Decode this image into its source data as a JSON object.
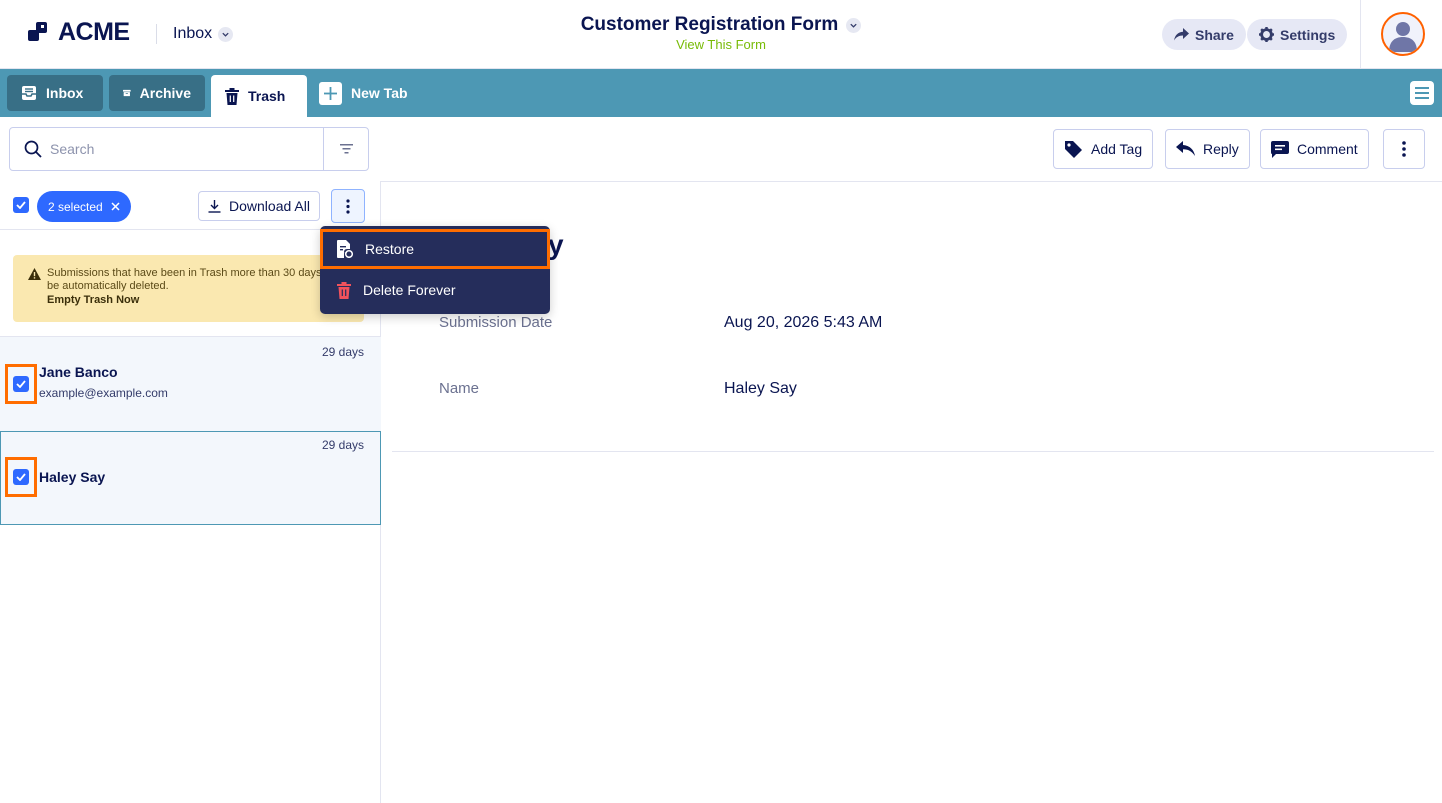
{
  "header": {
    "brand": "ACME",
    "inbox_label": "Inbox",
    "form_title": "Customer Registration Form",
    "form_subtitle": "View This Form",
    "share_label": "Share",
    "settings_label": "Settings"
  },
  "tabs": [
    {
      "label": "Inbox",
      "icon": "inbox-icon"
    },
    {
      "label": "Archive",
      "icon": "archive-icon"
    },
    {
      "label": "Trash",
      "icon": "trash-icon",
      "active": true
    },
    {
      "label": "New Tab",
      "icon": "plus-icon"
    }
  ],
  "search": {
    "placeholder": "Search",
    "value": ""
  },
  "actions": {
    "add_tag": "Add Tag",
    "reply": "Reply",
    "comment": "Comment"
  },
  "selection": {
    "badge": "2 selected",
    "download_all": "Download All"
  },
  "warning": {
    "text": "Submissions that have been in Trash more than 30 days will be automatically deleted.",
    "link": "Empty Trash Now"
  },
  "submissions": [
    {
      "name": "Jane Banco",
      "email": "example@example.com",
      "age": "29 days",
      "checked": true
    },
    {
      "name": "Haley Say",
      "email": "",
      "age": "29 days",
      "checked": true
    }
  ],
  "detail": {
    "title_fragment": "y",
    "fields": [
      {
        "label": "Submission Date",
        "value": "Aug 20, 2026 5:43 AM"
      },
      {
        "label": "Name",
        "value": "Haley Say"
      }
    ]
  },
  "menu": {
    "restore": "Restore",
    "delete_forever": "Delete Forever"
  },
  "colors": {
    "navy": "#0a1551",
    "tabbar": "#4d98b4",
    "accent_blue": "#2e69ff",
    "highlight": "#ff6d00",
    "menu_bg": "#252d5b",
    "warning_bg": "#fae8b0",
    "link_green": "#78bb07"
  }
}
